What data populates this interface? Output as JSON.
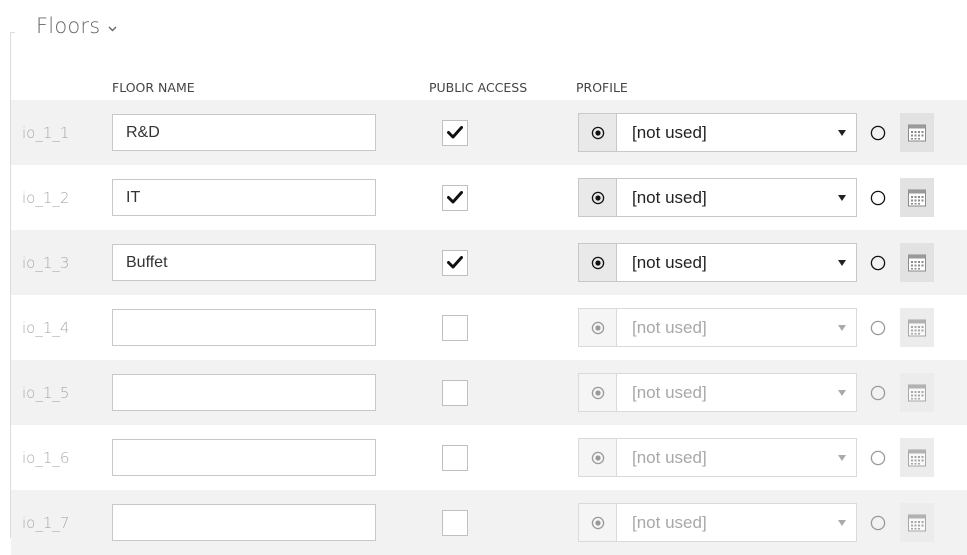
{
  "section": {
    "title": "Floors"
  },
  "columns": {
    "floor_name": "FLOOR NAME",
    "public_access": "PUBLIC ACCESS",
    "profile": "PROFILE"
  },
  "rows": [
    {
      "id": "io_1_1",
      "floor_name": "R&D",
      "public_access": true,
      "profile": "[not used]",
      "enabled": true
    },
    {
      "id": "io_1_2",
      "floor_name": "IT",
      "public_access": true,
      "profile": "[not used]",
      "enabled": true
    },
    {
      "id": "io_1_3",
      "floor_name": "Buffet",
      "public_access": true,
      "profile": "[not used]",
      "enabled": true
    },
    {
      "id": "io_1_4",
      "floor_name": "",
      "public_access": false,
      "profile": "[not used]",
      "enabled": false
    },
    {
      "id": "io_1_5",
      "floor_name": "",
      "public_access": false,
      "profile": "[not used]",
      "enabled": false
    },
    {
      "id": "io_1_6",
      "floor_name": "",
      "public_access": false,
      "profile": "[not used]",
      "enabled": false
    },
    {
      "id": "io_1_7",
      "floor_name": "",
      "public_access": false,
      "profile": "[not used]",
      "enabled": false
    }
  ],
  "icons": {
    "collapse": "chevron-down-icon",
    "check": "checkmark-icon",
    "radio": "radio-icon",
    "calendar": "calendar-icon"
  },
  "colors": {
    "stripe": "#f2f2f2",
    "muted_text": "#a9a9a9"
  }
}
